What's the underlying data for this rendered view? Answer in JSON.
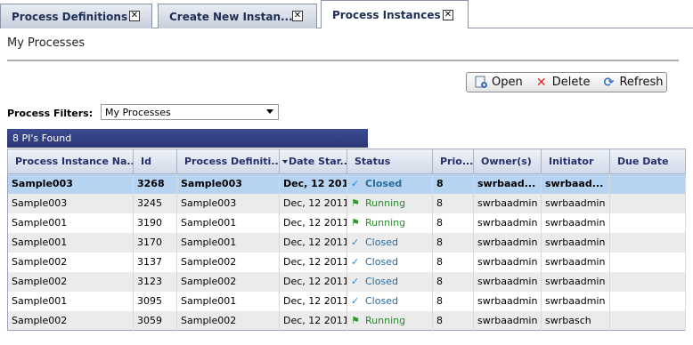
{
  "tabs": [
    {
      "label": "Process Definitions"
    },
    {
      "label": "Create New Instan..."
    },
    {
      "label": "Process Instances",
      "active": true
    }
  ],
  "page": {
    "title": "My Processes"
  },
  "toolbar": {
    "open_label": "Open",
    "delete_label": "Delete",
    "refresh_label": "Refresh"
  },
  "filters": {
    "label": "Process Filters:",
    "selected": "My Processes"
  },
  "results": {
    "count_text": "8 PI's Found"
  },
  "table": {
    "columns": [
      "Process Instance Na...",
      "Id",
      "Process Definiti...",
      "Date Star...",
      "Status",
      "Prio...",
      "Owner(s)",
      "Initiator",
      "Due Date"
    ],
    "rows": [
      {
        "name": "Sample003",
        "id": "3268",
        "definition": "Sample003",
        "date": "Dec, 12 2011",
        "status": "Closed",
        "priority": "8",
        "owner": "swrbaad...",
        "initiator": "swrbaad...",
        "due": "",
        "selected": true
      },
      {
        "name": "Sample003",
        "id": "3245",
        "definition": "Sample003",
        "date": "Dec, 12 2011",
        "status": "Running",
        "priority": "8",
        "owner": "swrbaadmin",
        "initiator": "swrbaadmin",
        "due": ""
      },
      {
        "name": "Sample001",
        "id": "3190",
        "definition": "Sample001",
        "date": "Dec, 12 2011",
        "status": "Running",
        "priority": "8",
        "owner": "swrbaadmin",
        "initiator": "swrbaadmin",
        "due": ""
      },
      {
        "name": "Sample001",
        "id": "3170",
        "definition": "Sample001",
        "date": "Dec, 12 2011",
        "status": "Closed",
        "priority": "8",
        "owner": "swrbaadmin",
        "initiator": "swrbaadmin",
        "due": ""
      },
      {
        "name": "Sample002",
        "id": "3137",
        "definition": "Sample002",
        "date": "Dec, 12 2011",
        "status": "Closed",
        "priority": "8",
        "owner": "swrbaadmin",
        "initiator": "swrbaadmin",
        "due": ""
      },
      {
        "name": "Sample002",
        "id": "3123",
        "definition": "Sample002",
        "date": "Dec, 12 2011",
        "status": "Closed",
        "priority": "8",
        "owner": "swrbaadmin",
        "initiator": "swrbaadmin",
        "due": ""
      },
      {
        "name": "Sample001",
        "id": "3095",
        "definition": "Sample001",
        "date": "Dec, 12 2011",
        "status": "Closed",
        "priority": "8",
        "owner": "swrbaadmin",
        "initiator": "swrbaadmin",
        "due": ""
      },
      {
        "name": "Sample002",
        "id": "3059",
        "definition": "Sample002",
        "date": "Dec, 12 2011",
        "status": "Running",
        "priority": "8",
        "owner": "swrbaadmin",
        "initiator": "swrbasch",
        "due": ""
      }
    ]
  },
  "colors": {
    "header_bar": "#2a3674",
    "selected_row": "#b6d3f2",
    "status_closed": "#2a86c8",
    "status_running": "#2a9b2a"
  },
  "icons": {
    "tab_close": "close-icon",
    "open": "open-icon",
    "delete": "delete-icon",
    "refresh": "refresh-icon",
    "sort": "sort-desc-icon",
    "closed": "checkmark-icon",
    "running": "flag-icon"
  }
}
